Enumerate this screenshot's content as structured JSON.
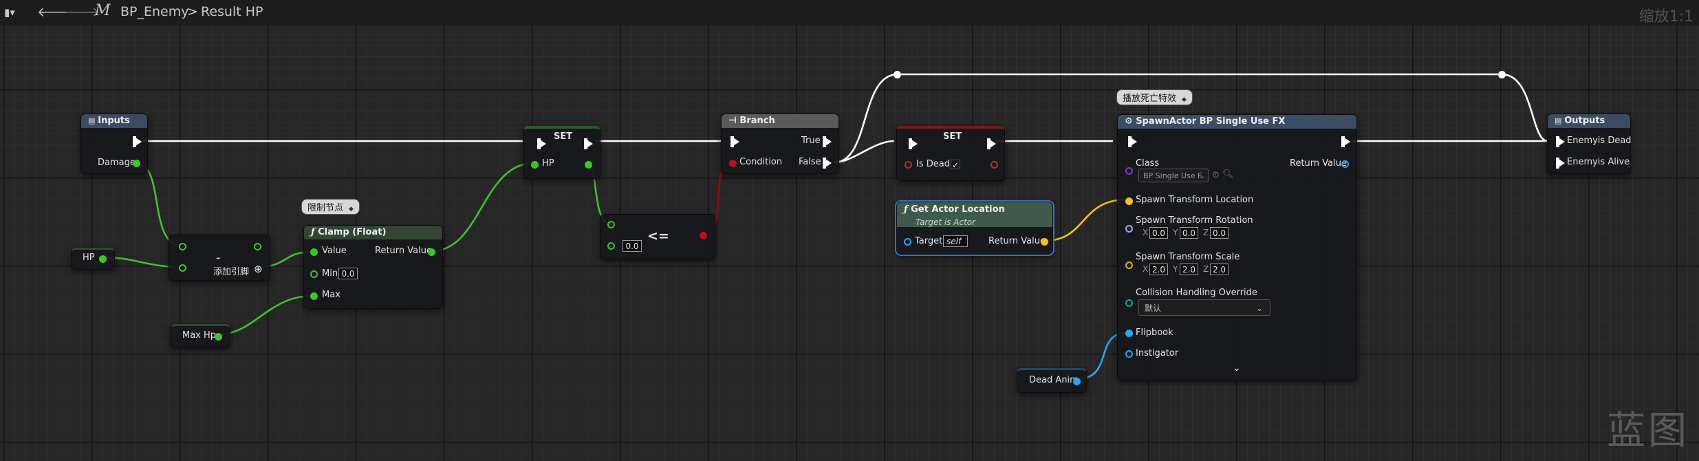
{
  "toolbar": {
    "back_icon": "arrow-left-icon",
    "forward_icon": "arrow-right-icon",
    "breadcrumb_root": "BP_Enemy",
    "breadcrumb_separator": ">",
    "breadcrumb_current": "Result HP",
    "zoom": "缩放1:1"
  },
  "watermark": "蓝图",
  "comments": {
    "clamp": "限制节点",
    "spawn": "播放死亡特效"
  },
  "nodes": {
    "inputs": {
      "title": "Inputs",
      "damage": "Damage"
    },
    "hp_var": {
      "label": "HP"
    },
    "max_hp_var": {
      "label": "Max Hp"
    },
    "subtract": {
      "symbol": "-",
      "add_pin": "添加引脚"
    },
    "clamp": {
      "title": "Clamp (Float)",
      "value": "Value",
      "min": "Min",
      "min_value": "0.0",
      "max": "Max",
      "return": "Return Value"
    },
    "set_hp": {
      "title": "SET",
      "pin": "HP"
    },
    "compare": {
      "symbol": "<=",
      "value": "0.0"
    },
    "branch": {
      "title": "Branch",
      "true": "True",
      "false": "False",
      "condition": "Condition"
    },
    "set_dead": {
      "title": "SET",
      "pin": "Is Dead",
      "checked": "✓"
    },
    "get_location": {
      "title": "Get Actor Location",
      "subtitle": "Target is Actor",
      "target": "Target",
      "target_value": "self",
      "return": "Return Value"
    },
    "dead_anim": {
      "label": "Dead Anim"
    },
    "spawn": {
      "title": "SpawnActor BP Single Use FX",
      "class": "Class",
      "class_value": "BP Single Use F",
      "return": "Return Value",
      "location": "Spawn Transform Location",
      "rotation": "Spawn Transform Rotation",
      "rot_x": "0.0",
      "rot_y": "0.0",
      "rot_z": "0.0",
      "scale": "Spawn Transform Scale",
      "scale_x": "2.0",
      "scale_y": "2.0",
      "scale_z": "2.0",
      "axis_x": "X",
      "axis_y": "Y",
      "axis_z": "Z",
      "collision": "Collision Handling Override",
      "collision_value": "默认",
      "flipbook": "Flipbook",
      "instigator": "Instigator"
    },
    "outputs": {
      "title": "Outputs",
      "dead": "Enemyis Dead",
      "alive": "Enemyis Alive"
    }
  },
  "colors": {
    "exec_wire": "#ffffff",
    "float_wire": "#3ec52a",
    "bool_wire": "#8a0d14",
    "vector_wire": "#f2c21a",
    "object_wire": "#2aa7f0",
    "selection": "#3a6ec8"
  }
}
